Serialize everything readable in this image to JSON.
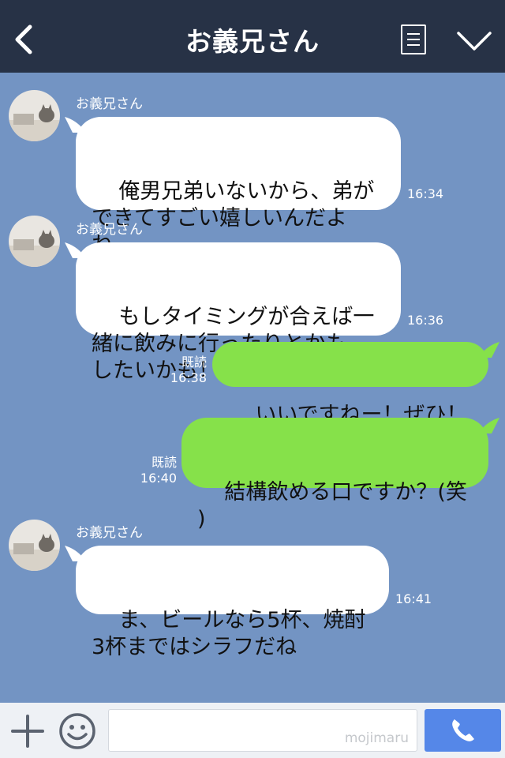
{
  "header": {
    "title": "お義兄さん"
  },
  "messages": [
    {
      "side": "in",
      "sender": "お義兄さん",
      "text": "俺男兄弟いないから、弟が\nできてすごい嬉しいんだよ\nね",
      "time": "16:34"
    },
    {
      "side": "in",
      "sender": "お義兄さん",
      "text": "もしタイミングが合えば一\n緒に飲みに行ったりとかも\nしたいかも！",
      "time": "16:36"
    },
    {
      "side": "out",
      "read": "既読",
      "text": "いいですねー！ぜひ！",
      "time": "16:38"
    },
    {
      "side": "out",
      "read": "既読",
      "text": "結構飲める口ですか？(笑\n)",
      "time": "16:40"
    },
    {
      "side": "in",
      "sender": "お義兄さん",
      "text": "ま、ビールなら5杯、焼酎\n3杯まではシラフだね",
      "time": "16:41"
    }
  ],
  "footer": {
    "watermark": "mojimaru"
  },
  "icons": {
    "back": "chevron-left-icon",
    "menu": "menu-list-icon",
    "collapse": "chevron-down-icon",
    "plus": "plus-icon",
    "emoji": "smile-icon",
    "call": "phone-icon"
  },
  "colors": {
    "header": "#273246",
    "chat_bg": "#7394c3",
    "out_bubble": "#86e14a",
    "in_bubble": "#ffffff",
    "call_button": "#5587e8"
  }
}
